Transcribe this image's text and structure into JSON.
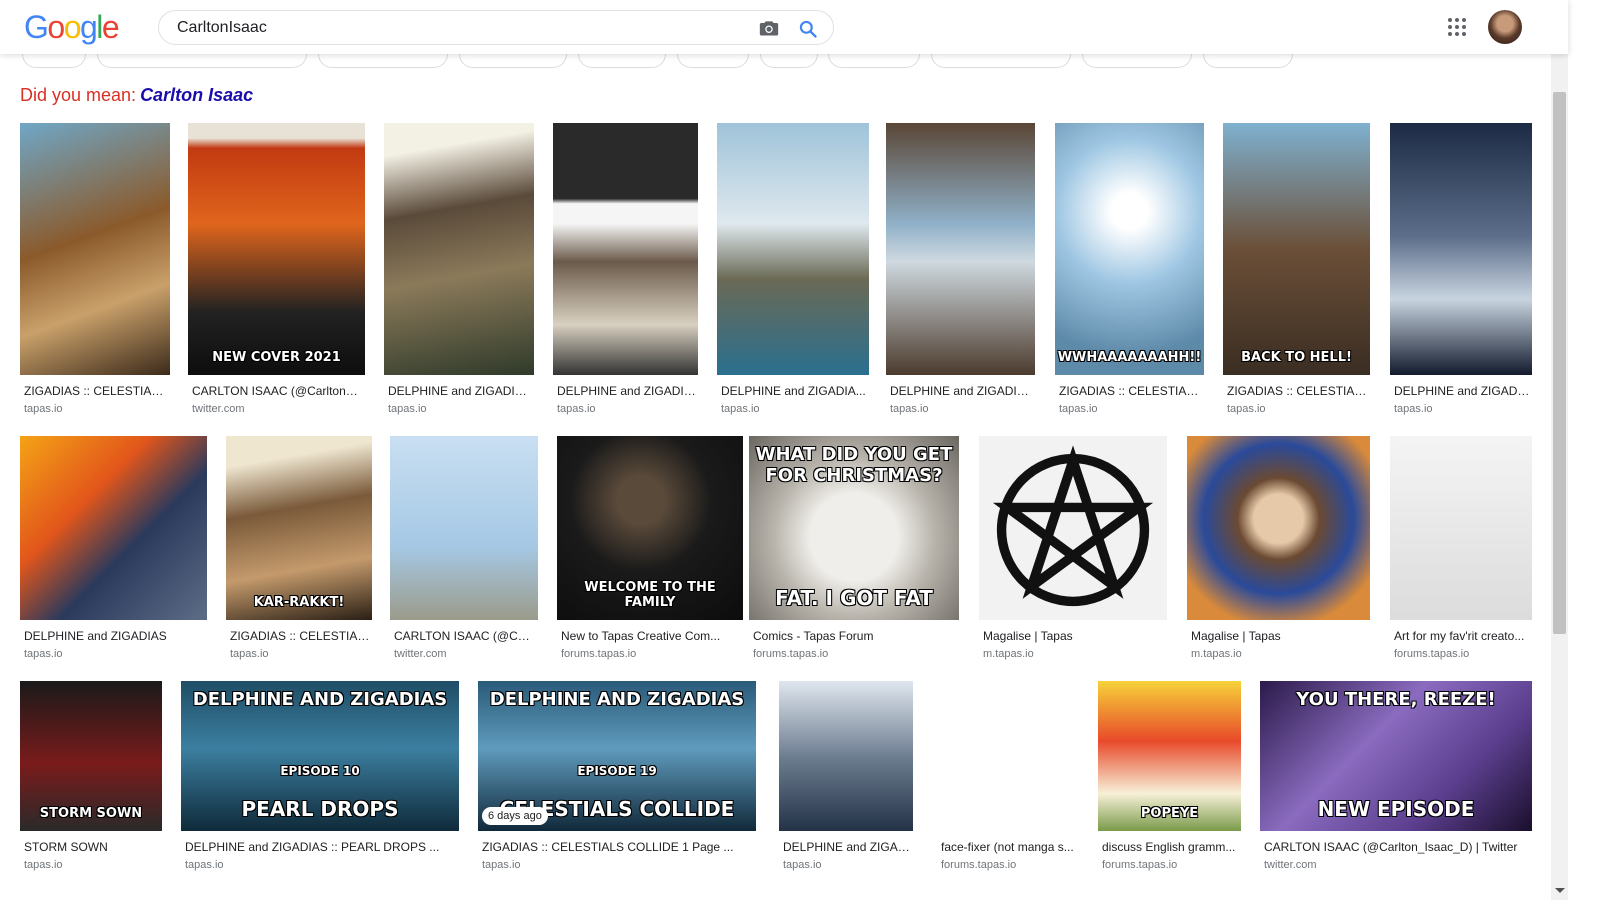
{
  "logo": [
    "G",
    "o",
    "o",
    "g",
    "l",
    "e"
  ],
  "logo_colors": [
    "#4285f4",
    "#ea4335",
    "#fbbc05",
    "#4285f4",
    "#34a853",
    "#ea4335"
  ],
  "search": {
    "query": "CarltonIsaac"
  },
  "did_you_mean": {
    "label": "Did you mean:",
    "suggestion": "Carlton Isaac"
  },
  "results": [
    {
      "title": "ZIGADIAS :: CELESTIALS...",
      "source": "tapas.io"
    },
    {
      "title": "CARLTON ISAAC (@Carlton_I...",
      "source": "twitter.com",
      "overlay": "NEW COVER 2021"
    },
    {
      "title": "DELPHINE and ZIGADIA...",
      "source": "tapas.io"
    },
    {
      "title": "DELPHINE and ZIGADIA...",
      "source": "tapas.io"
    },
    {
      "title": "DELPHINE and ZIGADIA...",
      "source": "tapas.io"
    },
    {
      "title": "DELPHINE and ZIGADIA...",
      "source": "tapas.io"
    },
    {
      "title": "ZIGADIAS :: CELESTIALS...",
      "source": "tapas.io",
      "overlay": "WWHAAAAAAAHH!!"
    },
    {
      "title": "ZIGADIAS :: CELESTIAL...",
      "source": "tapas.io",
      "overlay": "BACK TO HELL!"
    },
    {
      "title": "DELPHINE and ZIGADI...",
      "source": "tapas.io"
    },
    {
      "title": "DELPHINE and ZIGADIAS",
      "source": "tapas.io"
    },
    {
      "title": "ZIGADIAS :: CELESTIAL...",
      "source": "tapas.io",
      "overlay": "KAR-RAKKT!"
    },
    {
      "title": "CARLTON ISAAC (@Carl...",
      "source": "twitter.com"
    },
    {
      "title": "New to Tapas Creative Com...",
      "source": "forums.tapas.io",
      "overlay": "WELCOME TO THE FAMILY"
    },
    {
      "title": "Comics - Tapas Forum",
      "source": "forums.tapas.io",
      "overlay_top": "WHAT DID YOU GET FOR CHRISTMAS?",
      "overlay": "FAT. I GOT FAT"
    },
    {
      "title": "Magalise | Tapas",
      "source": "m.tapas.io"
    },
    {
      "title": "Magalise | Tapas",
      "source": "m.tapas.io"
    },
    {
      "title": "Art for my fav'rit creato...",
      "source": "forums.tapas.io"
    },
    {
      "title": "STORM SOWN",
      "source": "tapas.io",
      "overlay": "STORM SOWN"
    },
    {
      "title": "DELPHINE and ZIGADIAS :: PEARL DROPS ...",
      "source": "tapas.io",
      "overlay_top": "DELPHINE AND ZIGADIAS",
      "overlay": "PEARL DROPS",
      "overlay_sub": "EPISODE 10"
    },
    {
      "title": "ZIGADIAS :: CELESTIALS COLLIDE 1 Page ...",
      "source": "tapas.io",
      "overlay_top": "DELPHINE AND ZIGADIAS",
      "overlay": "CELESTIALS COLLIDE",
      "overlay_sub": "EPISODE 19",
      "badge": "6 days ago"
    },
    {
      "title": "DELPHINE and ZIGADI...",
      "source": "tapas.io"
    },
    {
      "title": "face-fixer (not manga s...",
      "source": "forums.tapas.io"
    },
    {
      "title": "discuss English gramm...",
      "source": "forums.tapas.io",
      "overlay": "POPEYE"
    },
    {
      "title": "CARLTON ISAAC (@Carlton_Isaac_D) | Twitter",
      "source": "twitter.com",
      "overlay_top": "YOU THERE, REEZE!",
      "overlay": "NEW EPISODE"
    }
  ]
}
